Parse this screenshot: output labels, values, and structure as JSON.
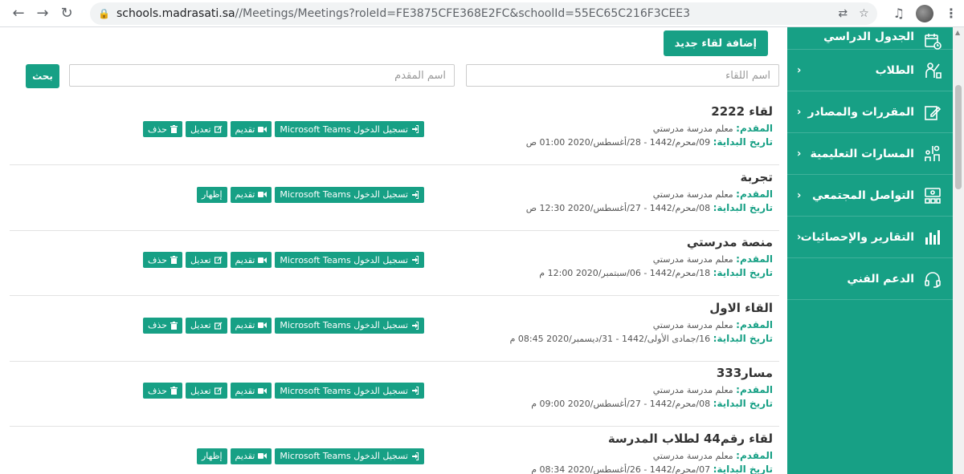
{
  "browser": {
    "url_host": "schools.madrasati.sa",
    "url_path": "//Meetings/Meetings?roleId=FE3875CFE368E2FC&schoolId=55EC65C216F3CEE3"
  },
  "sidebar": {
    "items": [
      {
        "label": "الجدول الدراسي",
        "icon": "calendar-icon",
        "chevron": false
      },
      {
        "label": "الطلاب",
        "icon": "student-icon",
        "chevron": true
      },
      {
        "label": "المقررات والمصادر",
        "icon": "edit-icon",
        "chevron": true
      },
      {
        "label": "المسارات التعليمية",
        "icon": "classroom-icon",
        "chevron": true
      },
      {
        "label": "التواصل المجتمعي",
        "icon": "community-icon",
        "chevron": true
      },
      {
        "label": "التقارير والإحصائيات",
        "icon": "bar-chart-icon",
        "chevron": true
      },
      {
        "label": "الدعم الفني",
        "icon": "headset-icon",
        "chevron": false
      }
    ]
  },
  "toolbar": {
    "add_label": "إضافة لقاء جديد",
    "meeting_name_placeholder": "اسم اللقاء",
    "presenter_placeholder": "اسم المقدم",
    "search_label": "بحث"
  },
  "labels": {
    "presenter": "المقدم:",
    "start": "تاريخ البداية:",
    "login": "تسجيل الدخول Microsoft Teams",
    "present": "تقديم",
    "edit": "تعديل",
    "delete": "حذف",
    "show": "إظهار"
  },
  "meetings": [
    {
      "title": "لقاء 2222",
      "presenter": "معلم مدرسة مدرستي",
      "start": "09/محرم/1442 - 28/أغسطس/2020 01:00 ص",
      "mode": "edit"
    },
    {
      "title": "تجربة",
      "presenter": "معلم مدرسة مدرستي",
      "start": "08/محرم/1442 - 27/أغسطس/2020 12:30 ص",
      "mode": "show"
    },
    {
      "title": "منصة مدرستي",
      "presenter": "معلم مدرسة مدرستي",
      "start": "18/محرم/1442 - 06/سبتمبر/2020 12:00 م",
      "mode": "edit"
    },
    {
      "title": "القاء الاول",
      "presenter": "معلم مدرسة مدرستي",
      "start": "16/جمادى الأولى/1442 - 31/ديسمبر/2020 08:45 م",
      "mode": "edit"
    },
    {
      "title": "مسار333",
      "presenter": "معلم مدرسة مدرستي",
      "start": "08/محرم/1442 - 27/أغسطس/2020 09:00 م",
      "mode": "edit"
    },
    {
      "title": "لقاء رقم44 لطلاب المدرسة",
      "presenter": "معلم مدرسة مدرستي",
      "start": "07/محرم/1442 - 26/أغسطس/2020 08:34 م",
      "mode": "show"
    }
  ],
  "colors": {
    "accent": "#17a085"
  }
}
